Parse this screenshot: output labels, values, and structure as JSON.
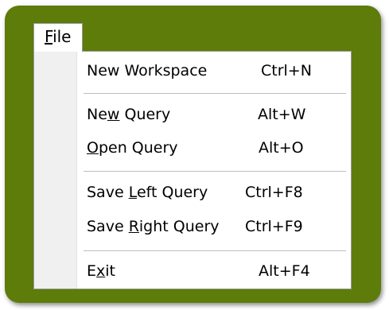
{
  "menubar": {
    "file_menu": {
      "prefix": "",
      "mnemonic": "F",
      "suffix": "ile"
    }
  },
  "menu": {
    "items": [
      {
        "label_pre": "New Workspace",
        "mnemonic": "",
        "label_post": "",
        "shortcut": "Ctrl+N"
      },
      {
        "label_pre": "Ne",
        "mnemonic": "w",
        "label_post": " Query",
        "shortcut": "Alt+W"
      },
      {
        "label_pre": "",
        "mnemonic": "O",
        "label_post": "pen Query",
        "shortcut": "Alt+O"
      },
      {
        "label_pre": "Save ",
        "mnemonic": "L",
        "label_post": "eft Query",
        "shortcut": "Ctrl+F8"
      },
      {
        "label_pre": "Save ",
        "mnemonic": "R",
        "label_post": "ight Query",
        "shortcut": "Ctrl+F9"
      },
      {
        "label_pre": "E",
        "mnemonic": "x",
        "label_post": "it",
        "shortcut": "Alt+F4"
      }
    ]
  },
  "colors": {
    "frame": "#5d7c09",
    "menu_background": "#ffffff",
    "gutter": "#f0f0f0",
    "separator": "#bfbfbf"
  }
}
